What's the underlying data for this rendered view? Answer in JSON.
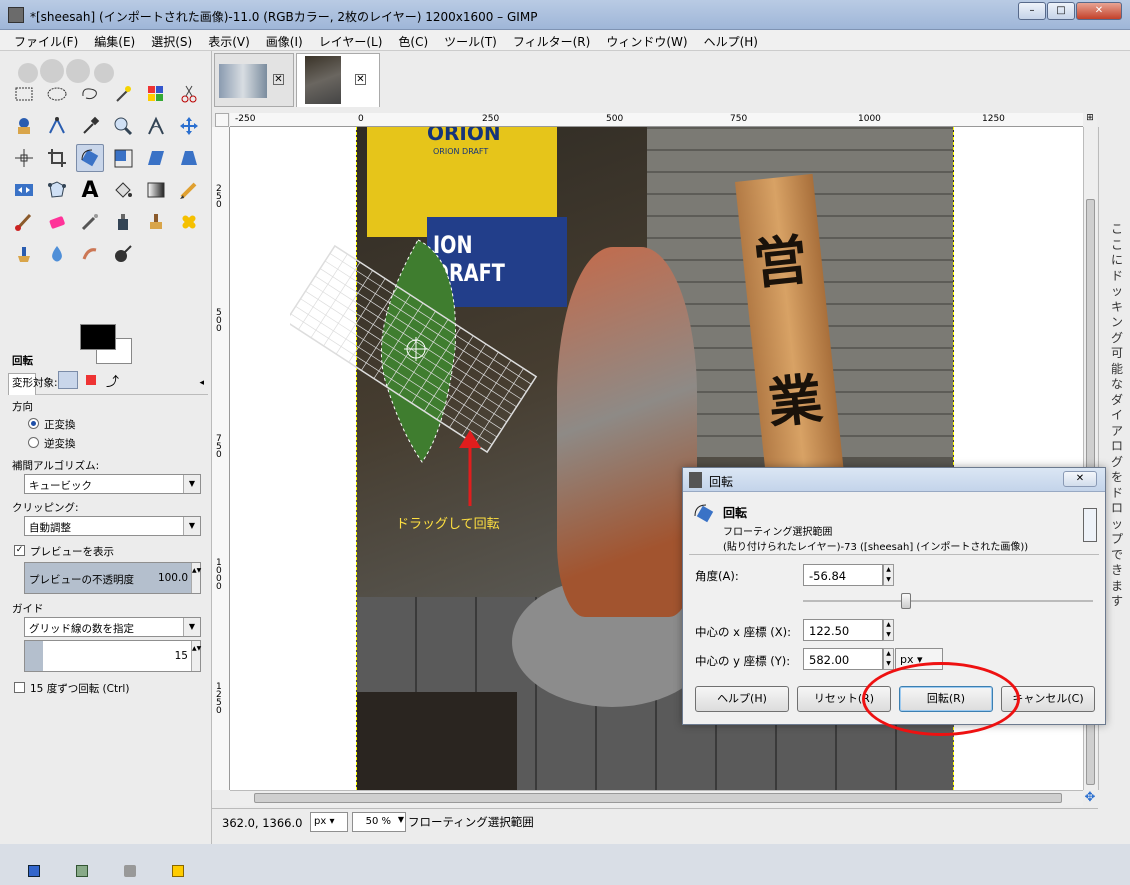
{
  "window": {
    "title": "*[sheesah] (インポートされた画像)-11.0 (RGBカラー, 2枚のレイヤー) 1200x1600 – GIMP",
    "buttons": {
      "minimize": "–",
      "maximize": "□",
      "close": "✕"
    }
  },
  "menubar": {
    "items": [
      "ファイル(F)",
      "編集(E)",
      "選択(S)",
      "表示(V)",
      "画像(I)",
      "レイヤー(L)",
      "色(C)",
      "ツール(T)",
      "フィルター(R)",
      "ウィンドウ(W)",
      "ヘルプ(H)"
    ]
  },
  "tool_options": {
    "tool_name": "回転",
    "transform_label": "変形対象:",
    "direction_label": "方向",
    "direction_normal": "正変換",
    "direction_reverse": "逆変換",
    "interp_label": "補間アルゴリズム:",
    "interp_value": "キュービック",
    "clip_label": "クリッピング:",
    "clip_value": "自動調整",
    "preview_label": "プレビューを表示",
    "preview_opacity_label": "プレビューの不透明度",
    "preview_opacity_value": "100.0",
    "guide_label": "ガイド",
    "guide_value": "グリッド線の数を指定",
    "guide_count": "15",
    "snap_label": "15 度ずつ回転 (Ctrl)"
  },
  "rulers": {
    "h_ticks": [
      "-250",
      "0",
      "250",
      "500",
      "750",
      "1000",
      "1250"
    ],
    "v_ticks": [
      "2\n5\n0",
      "5\n0\n0",
      "7\n5\n0",
      "1\n0\n0\n0",
      "1\n2\n5\n0"
    ]
  },
  "image_text": {
    "banner_top": "ORION",
    "banner_sub": "ORION DRAFT",
    "banner_main": "ION DRAFT",
    "sign_char1": "営",
    "sign_char2": "業"
  },
  "annotation": {
    "drag_label": "ドラッグして回転",
    "color": "#e11d1d",
    "label_color": "#ffe040"
  },
  "dock_hint": "ここにドッキング可能なダイアログをドロップできます",
  "statusbar": {
    "coords": "362.0, 1366.0",
    "unit": "px",
    "zoom": "50 %",
    "message": "フローティング選択範囲"
  },
  "dialog": {
    "title": "回転",
    "header_title": "回転",
    "header_sub1": "フローティング選択範囲",
    "header_sub2": "(貼り付けられたレイヤー)-73 ([sheesah] (インポートされた画像))",
    "angle_label": "角度(A):",
    "angle_value": "-56.84",
    "angle_slider_fraction": 0.355,
    "cx_label": "中心の x 座標 (X):",
    "cx_value": "122.50",
    "cy_label": "中心の y 座標 (Y):",
    "cy_value": "582.00",
    "unit": "px",
    "help_button": "ヘルプ(H)",
    "reset_button": "リセット(R)",
    "rotate_button": "回転(R)",
    "cancel_button": "キャンセル(C)"
  }
}
